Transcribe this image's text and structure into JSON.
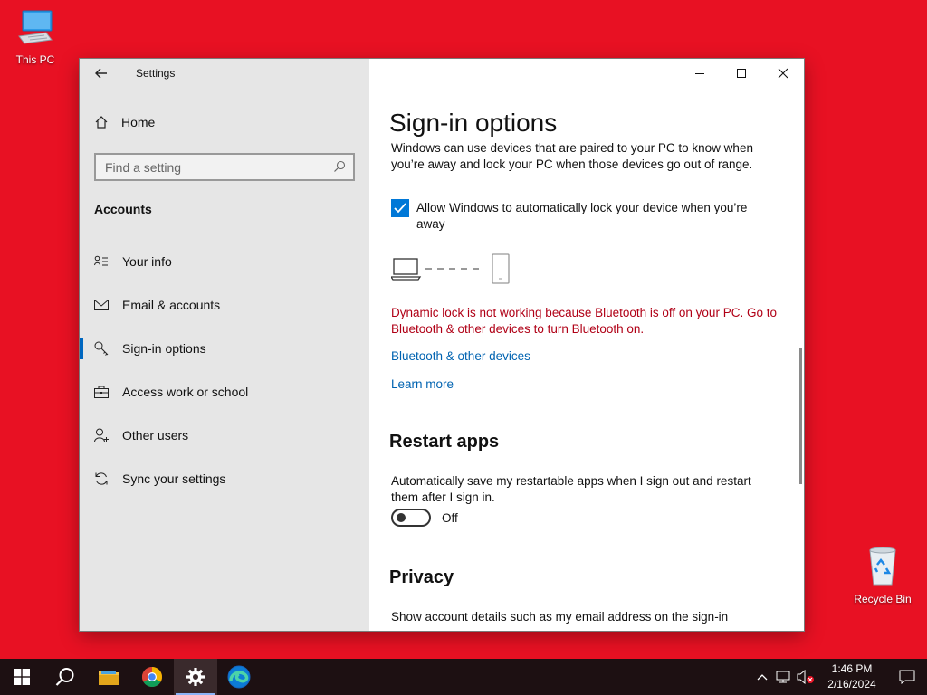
{
  "desktop": {
    "icons": [
      {
        "label": "This PC"
      },
      {
        "label": "Recycle Bin"
      }
    ]
  },
  "window": {
    "title": "Settings",
    "sidebar": {
      "home_label": "Home",
      "search_placeholder": "Find a setting",
      "section_label": "Accounts",
      "items": [
        {
          "label": "Your info",
          "icon": "person-card-icon"
        },
        {
          "label": "Email & accounts",
          "icon": "mail-icon"
        },
        {
          "label": "Sign-in options",
          "icon": "key-icon",
          "active": true
        },
        {
          "label": "Access work or school",
          "icon": "briefcase-icon"
        },
        {
          "label": "Other users",
          "icon": "person-add-icon"
        },
        {
          "label": "Sync your settings",
          "icon": "sync-icon"
        }
      ]
    },
    "main": {
      "title": "Sign-in options",
      "intro": "Windows can use devices that are paired to your PC to know when you’re away and lock your PC when those devices go out of range.",
      "checkbox_label": "Allow Windows to automatically lock your device when you’re away",
      "checkbox_checked": true,
      "error_text": "Dynamic lock is not working because Bluetooth is off on your PC. Go to Bluetooth & other devices to turn Bluetooth on.",
      "link_bluetooth": "Bluetooth & other devices",
      "link_learn_more": "Learn more",
      "restart_heading": "Restart apps",
      "restart_desc": "Automatically save my restartable apps when I sign out and restart them after I sign in.",
      "restart_toggle_state": "Off",
      "privacy_heading": "Privacy",
      "privacy_desc": "Show account details such as my email address on the sign-in"
    }
  },
  "taskbar": {
    "apps": [
      "start-button",
      "search-button",
      "file-explorer",
      "chrome",
      "settings",
      "edge"
    ],
    "clock_time": "1:46 PM",
    "clock_date": "2/16/2024"
  },
  "colors": {
    "desktop_bg": "#e81123",
    "accent": "#0078d7",
    "error": "#b00016",
    "link": "#0063b1"
  }
}
